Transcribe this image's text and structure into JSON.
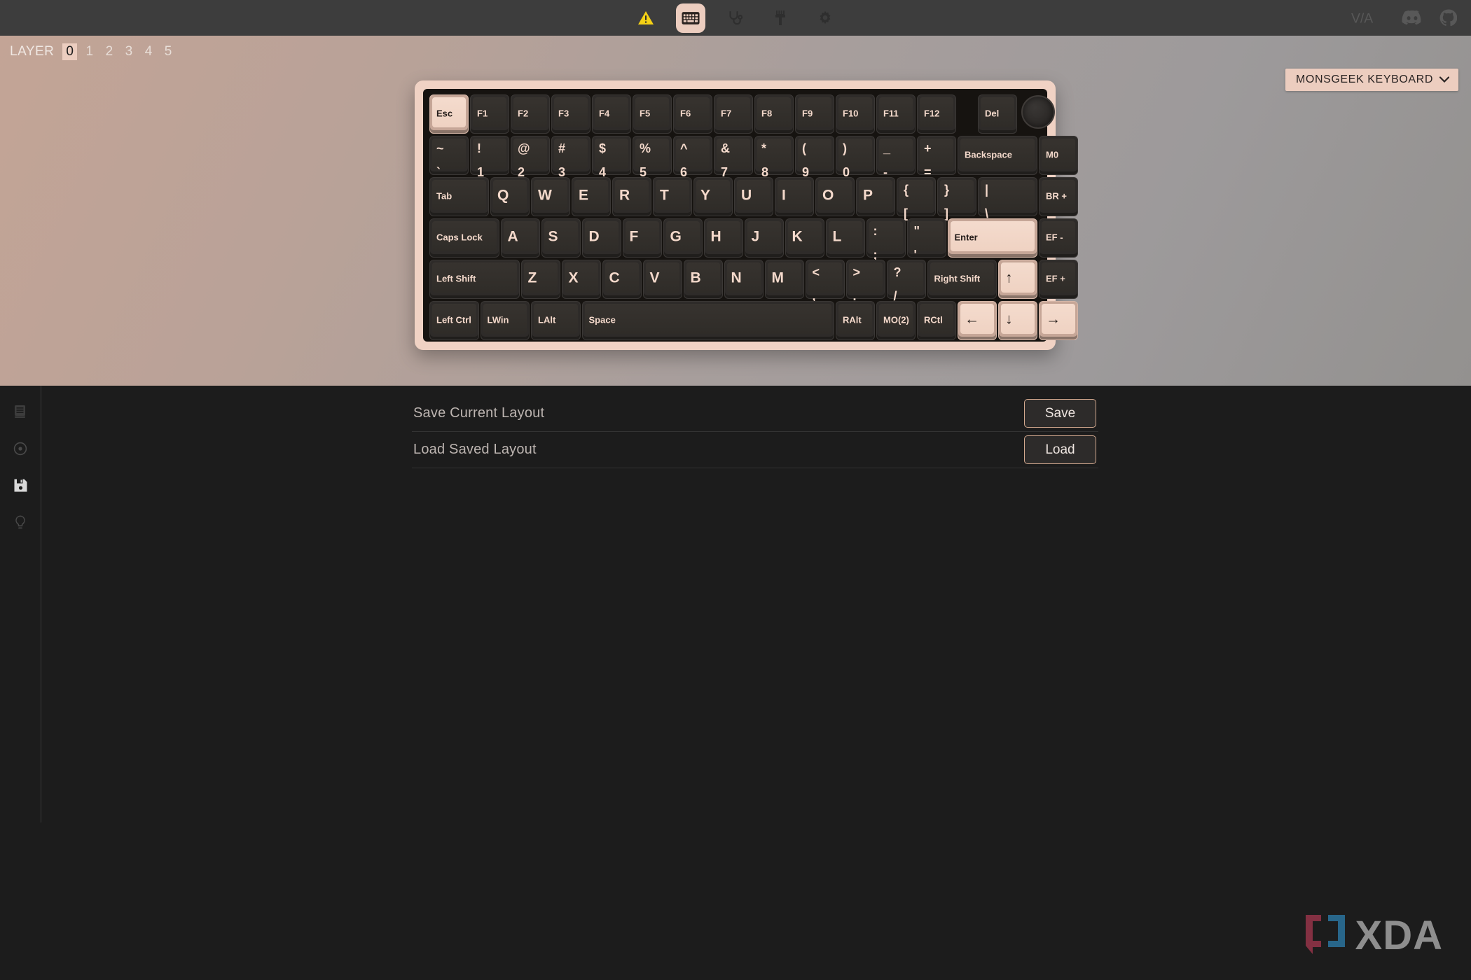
{
  "toolbar": {
    "icons": [
      {
        "name": "warning-icon",
        "label": "Warning",
        "active": false
      },
      {
        "name": "keyboard-icon",
        "label": "Keymap",
        "active": true
      },
      {
        "name": "stethoscope-icon",
        "label": "Key Tester",
        "active": false
      },
      {
        "name": "paintbrush-icon",
        "label": "Lighting",
        "active": false
      },
      {
        "name": "gear-icon",
        "label": "Settings",
        "active": false
      }
    ],
    "links": [
      {
        "name": "via-logo",
        "label": "VIA"
      },
      {
        "name": "discord-icon",
        "label": "Discord"
      },
      {
        "name": "github-icon",
        "label": "GitHub"
      }
    ]
  },
  "layer_bar": {
    "label": "LAYER",
    "layers": [
      "0",
      "1",
      "2",
      "3",
      "4",
      "5"
    ],
    "selected": "0"
  },
  "keyboard_select": {
    "label": "MONSGEEK KEYBOARD",
    "chevron": "chevron-down-icon"
  },
  "keyboard": {
    "rows": [
      [
        {
          "legend": "Esc",
          "w": 1.0,
          "style": "sm",
          "hi": true
        },
        {
          "legend": "F1",
          "w": 1.0,
          "style": "sm"
        },
        {
          "legend": "F2",
          "w": 1.0,
          "style": "sm"
        },
        {
          "legend": "F3",
          "w": 1.0,
          "style": "sm"
        },
        {
          "legend": "F4",
          "w": 1.0,
          "style": "sm"
        },
        {
          "legend": "F5",
          "w": 1.0,
          "style": "sm"
        },
        {
          "legend": "F6",
          "w": 1.0,
          "style": "sm"
        },
        {
          "legend": "F7",
          "w": 1.0,
          "style": "sm"
        },
        {
          "legend": "F8",
          "w": 1.0,
          "style": "sm"
        },
        {
          "legend": "F9",
          "w": 1.0,
          "style": "sm"
        },
        {
          "legend": "F10",
          "w": 1.0,
          "style": "sm"
        },
        {
          "legend": "F11",
          "w": 1.0,
          "style": "sm"
        },
        {
          "legend": "F12",
          "w": 1.0,
          "style": "sm"
        },
        {
          "gap": 0.5
        },
        {
          "legend": "Del",
          "w": 1.0,
          "style": "sm"
        },
        {
          "encoder": true,
          "w": 1.0
        }
      ],
      [
        {
          "top": "~",
          "bot": "`",
          "w": 1.0,
          "style": "dual"
        },
        {
          "top": "!",
          "bot": "1",
          "w": 1.0,
          "style": "dual"
        },
        {
          "top": "@",
          "bot": "2",
          "w": 1.0,
          "style": "dual"
        },
        {
          "top": "#",
          "bot": "3",
          "w": 1.0,
          "style": "dual"
        },
        {
          "top": "$",
          "bot": "4",
          "w": 1.0,
          "style": "dual"
        },
        {
          "top": "%",
          "bot": "5",
          "w": 1.0,
          "style": "dual"
        },
        {
          "top": "^",
          "bot": "6",
          "w": 1.0,
          "style": "dual"
        },
        {
          "top": "&",
          "bot": "7",
          "w": 1.0,
          "style": "dual"
        },
        {
          "top": "*",
          "bot": "8",
          "w": 1.0,
          "style": "dual"
        },
        {
          "top": "(",
          "bot": "9",
          "w": 1.0,
          "style": "dual"
        },
        {
          "top": ")",
          "bot": "0",
          "w": 1.0,
          "style": "dual"
        },
        {
          "top": "_",
          "bot": "-",
          "w": 1.0,
          "style": "dual"
        },
        {
          "top": "+",
          "bot": "=",
          "w": 1.0,
          "style": "dual"
        },
        {
          "legend": "Backspace",
          "w": 2.0,
          "style": "sm"
        },
        {
          "legend": "M0",
          "w": 1.0,
          "style": "sm"
        }
      ],
      [
        {
          "legend": "Tab",
          "w": 1.5,
          "style": "sm"
        },
        {
          "legend": "Q",
          "w": 1.0,
          "style": "lg-alpha"
        },
        {
          "legend": "W",
          "w": 1.0,
          "style": "lg-alpha"
        },
        {
          "legend": "E",
          "w": 1.0,
          "style": "lg-alpha"
        },
        {
          "legend": "R",
          "w": 1.0,
          "style": "lg-alpha"
        },
        {
          "legend": "T",
          "w": 1.0,
          "style": "lg-alpha"
        },
        {
          "legend": "Y",
          "w": 1.0,
          "style": "lg-alpha"
        },
        {
          "legend": "U",
          "w": 1.0,
          "style": "lg-alpha"
        },
        {
          "legend": "I",
          "w": 1.0,
          "style": "lg-alpha"
        },
        {
          "legend": "O",
          "w": 1.0,
          "style": "lg-alpha"
        },
        {
          "legend": "P",
          "w": 1.0,
          "style": "lg-alpha"
        },
        {
          "top": "{",
          "bot": "[",
          "w": 1.0,
          "style": "dual"
        },
        {
          "top": "}",
          "bot": "]",
          "w": 1.0,
          "style": "dual"
        },
        {
          "top": "|",
          "bot": "\\",
          "w": 1.5,
          "style": "dual"
        },
        {
          "legend": "BR +",
          "w": 1.0,
          "style": "sm"
        }
      ],
      [
        {
          "legend": "Caps Lock",
          "w": 1.75,
          "style": "sm"
        },
        {
          "legend": "A",
          "w": 1.0,
          "style": "lg-alpha"
        },
        {
          "legend": "S",
          "w": 1.0,
          "style": "lg-alpha"
        },
        {
          "legend": "D",
          "w": 1.0,
          "style": "lg-alpha"
        },
        {
          "legend": "F",
          "w": 1.0,
          "style": "lg-alpha"
        },
        {
          "legend": "G",
          "w": 1.0,
          "style": "lg-alpha"
        },
        {
          "legend": "H",
          "w": 1.0,
          "style": "lg-alpha"
        },
        {
          "legend": "J",
          "w": 1.0,
          "style": "lg-alpha"
        },
        {
          "legend": "K",
          "w": 1.0,
          "style": "lg-alpha"
        },
        {
          "legend": "L",
          "w": 1.0,
          "style": "lg-alpha"
        },
        {
          "top": ":",
          "bot": ";",
          "w": 1.0,
          "style": "dual"
        },
        {
          "top": "\"",
          "bot": "'",
          "w": 1.0,
          "style": "dual"
        },
        {
          "legend": "Enter",
          "w": 2.25,
          "style": "sm",
          "hi": true
        },
        {
          "legend": "EF -",
          "w": 1.0,
          "style": "sm"
        }
      ],
      [
        {
          "legend": "Left Shift",
          "w": 2.25,
          "style": "sm"
        },
        {
          "legend": "Z",
          "w": 1.0,
          "style": "lg-alpha"
        },
        {
          "legend": "X",
          "w": 1.0,
          "style": "lg-alpha"
        },
        {
          "legend": "C",
          "w": 1.0,
          "style": "lg-alpha"
        },
        {
          "legend": "V",
          "w": 1.0,
          "style": "lg-alpha"
        },
        {
          "legend": "B",
          "w": 1.0,
          "style": "lg-alpha"
        },
        {
          "legend": "N",
          "w": 1.0,
          "style": "lg-alpha"
        },
        {
          "legend": "M",
          "w": 1.0,
          "style": "lg-alpha"
        },
        {
          "top": "<",
          "bot": ",",
          "w": 1.0,
          "style": "dual"
        },
        {
          "top": ">",
          "bot": ".",
          "w": 1.0,
          "style": "dual"
        },
        {
          "top": "?",
          "bot": "/",
          "w": 1.0,
          "style": "dual"
        },
        {
          "legend": "Right Shift",
          "w": 1.75,
          "style": "sm"
        },
        {
          "legend": "↑",
          "w": 1.0,
          "style": "lg-alpha",
          "hi": true
        },
        {
          "legend": "EF +",
          "w": 1.0,
          "style": "sm"
        }
      ],
      [
        {
          "legend": "Left Ctrl",
          "w": 1.25,
          "style": "sm"
        },
        {
          "legend": "LWin",
          "w": 1.25,
          "style": "sm"
        },
        {
          "legend": "LAlt",
          "w": 1.25,
          "style": "sm"
        },
        {
          "legend": "Space",
          "w": 6.25,
          "style": "sm"
        },
        {
          "legend": "RAlt",
          "w": 1.0,
          "style": "sm"
        },
        {
          "legend": "MO(2)",
          "w": 1.0,
          "style": "sm"
        },
        {
          "legend": "RCtl",
          "w": 1.0,
          "style": "sm"
        },
        {
          "legend": "←",
          "w": 1.0,
          "style": "lg-alpha",
          "hi": true
        },
        {
          "legend": "↓",
          "w": 1.0,
          "style": "lg-alpha",
          "hi": true
        },
        {
          "legend": "→",
          "w": 1.0,
          "style": "lg-alpha",
          "hi": true
        }
      ]
    ]
  },
  "sidebar": {
    "items": [
      {
        "name": "layout-icon",
        "label": "Layouts",
        "active": false
      },
      {
        "name": "record-macro-icon",
        "label": "Macros",
        "active": false
      },
      {
        "name": "save-icon",
        "label": "Save + Load",
        "active": true
      },
      {
        "name": "lightbulb-icon",
        "label": "Lighting",
        "active": false
      }
    ]
  },
  "settings": {
    "rows": [
      {
        "label": "Save Current Layout",
        "button": "Save",
        "button_name": "save-button"
      },
      {
        "label": "Load Saved Layout",
        "button": "Load",
        "button_name": "load-button"
      }
    ]
  },
  "watermark": {
    "text": "XDA"
  },
  "colors": {
    "accent": "#eccdbf",
    "case": "#f0d2c4",
    "plate": "#161310",
    "key": "#2e2b29",
    "panel_bg": "#1c1c1c",
    "toolbar_bg": "#3d3d3d",
    "warning": "#f5d115"
  }
}
